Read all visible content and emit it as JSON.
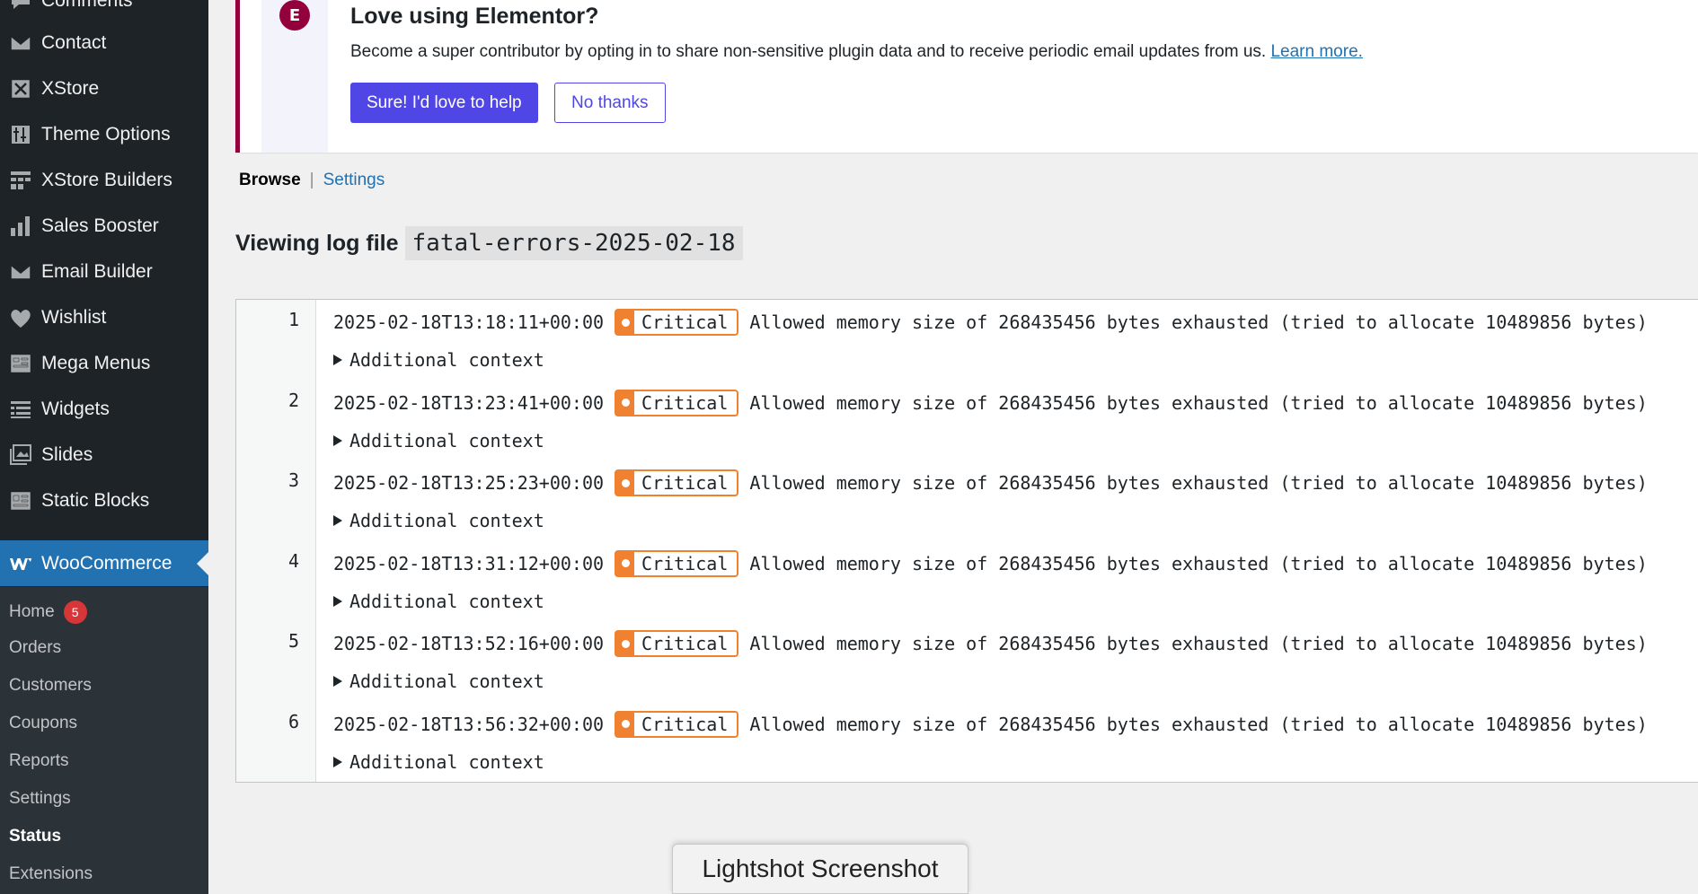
{
  "sidebar": {
    "items": [
      {
        "label": "Comments",
        "icon": "comments-icon"
      },
      {
        "label": "Contact",
        "icon": "mail-icon"
      },
      {
        "label": "XStore",
        "icon": "xstore-icon"
      },
      {
        "label": "Theme Options",
        "icon": "theme-options-icon"
      },
      {
        "label": "XStore Builders",
        "icon": "builders-icon"
      },
      {
        "label": "Sales Booster",
        "icon": "bar-chart-icon"
      },
      {
        "label": "Email Builder",
        "icon": "envelope-icon"
      },
      {
        "label": "Wishlist",
        "icon": "heart-icon"
      },
      {
        "label": "Mega Menus",
        "icon": "mega-menu-icon"
      },
      {
        "label": "Widgets",
        "icon": "widgets-icon"
      },
      {
        "label": "Slides",
        "icon": "slides-icon"
      },
      {
        "label": "Static Blocks",
        "icon": "static-blocks-icon"
      }
    ],
    "current": {
      "label": "WooCommerce",
      "icon": "woocommerce-icon"
    },
    "submenu": [
      {
        "label": "Home",
        "badge": "5"
      },
      {
        "label": "Orders"
      },
      {
        "label": "Customers"
      },
      {
        "label": "Coupons"
      },
      {
        "label": "Reports"
      },
      {
        "label": "Settings"
      },
      {
        "label": "Status",
        "active": true
      },
      {
        "label": "Extensions"
      }
    ]
  },
  "notice": {
    "logo": "E",
    "title": "Love using Elementor?",
    "text": "Become a super contributor by opting in to share non-sensitive plugin data and to receive periodic email updates from us.",
    "link": "Learn more.",
    "primary_button": "Sure! I'd love to help",
    "secondary_button": "No thanks"
  },
  "subnav": {
    "current": "Browse",
    "separator": "|",
    "link": "Settings"
  },
  "log": {
    "heading": "Viewing log file",
    "filename": "fatal-errors-2025-02-18",
    "context_label": "Additional context",
    "entries": [
      {
        "line": "1",
        "timestamp": "2025-02-18T13:18:11+00:00",
        "level": "Critical",
        "message": "Allowed memory size of 268435456 bytes exhausted (tried to allocate 10489856 bytes)"
      },
      {
        "line": "2",
        "timestamp": "2025-02-18T13:23:41+00:00",
        "level": "Critical",
        "message": "Allowed memory size of 268435456 bytes exhausted (tried to allocate 10489856 bytes)"
      },
      {
        "line": "3",
        "timestamp": "2025-02-18T13:25:23+00:00",
        "level": "Critical",
        "message": "Allowed memory size of 268435456 bytes exhausted (tried to allocate 10489856 bytes)"
      },
      {
        "line": "4",
        "timestamp": "2025-02-18T13:31:12+00:00",
        "level": "Critical",
        "message": "Allowed memory size of 268435456 bytes exhausted (tried to allocate 10489856 bytes)"
      },
      {
        "line": "5",
        "timestamp": "2025-02-18T13:52:16+00:00",
        "level": "Critical",
        "message": "Allowed memory size of 268435456 bytes exhausted (tried to allocate 10489856 bytes)"
      },
      {
        "line": "6",
        "timestamp": "2025-02-18T13:56:32+00:00",
        "level": "Critical",
        "message": "Allowed memory size of 268435456 bytes exhausted (tried to allocate 10489856 bytes)"
      }
    ]
  },
  "tooltip": {
    "text": "Lightshot Screenshot"
  },
  "colors": {
    "sidebar_bg": "#1d2327",
    "current_menu": "#2271b1",
    "critical": "#f08130",
    "elementor": "#93003c",
    "primary_button": "#5046e5"
  }
}
